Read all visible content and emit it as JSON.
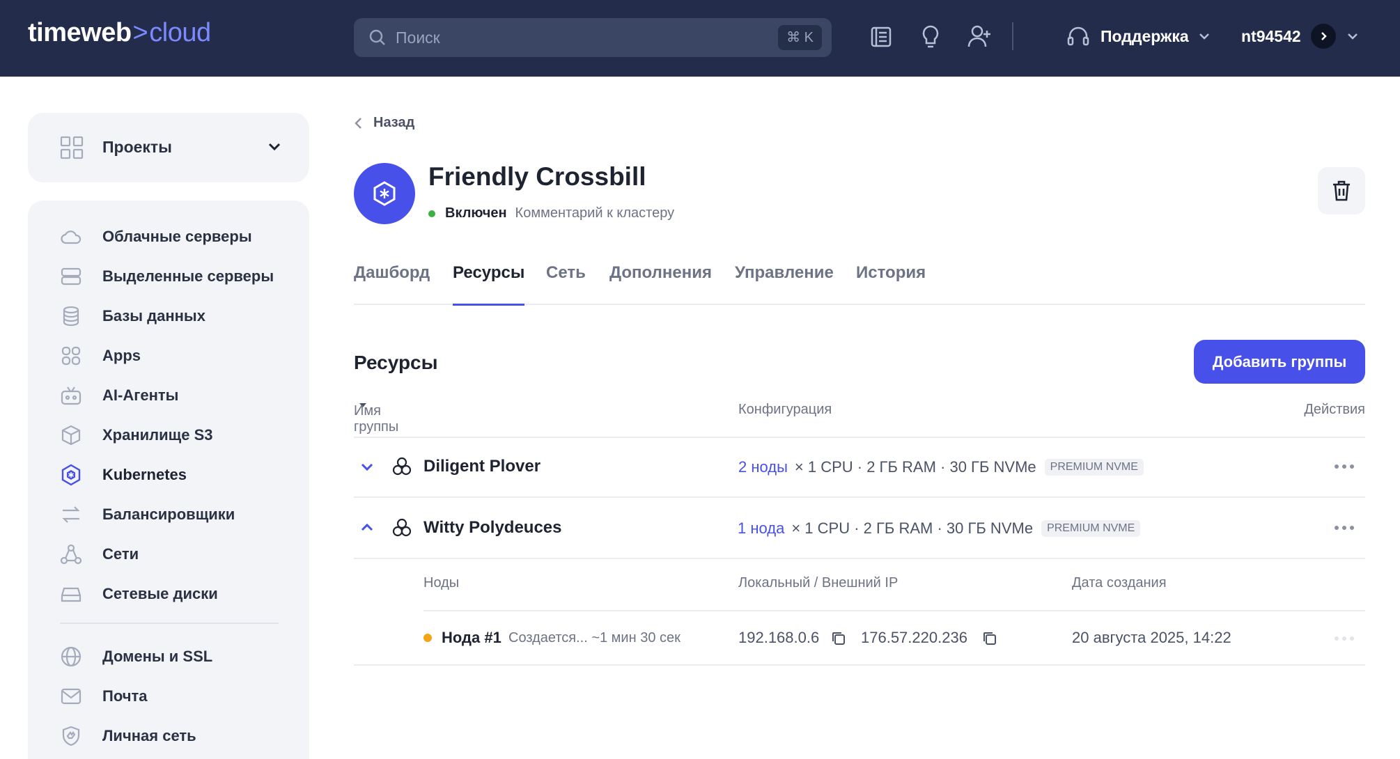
{
  "header": {
    "logo": {
      "part1": "timeweb",
      "part2": "cloud"
    },
    "search": {
      "placeholder": "Поиск",
      "shortcut": "⌘ K"
    },
    "icons": [
      "docs-icon",
      "lightbulb-icon",
      "add-user-icon"
    ],
    "support": "Поддержка",
    "user": "nt94542"
  },
  "sidebar": {
    "projects": "Проекты",
    "items": [
      {
        "label": "Облачные серверы",
        "icon": "cloud-icon"
      },
      {
        "label": "Выделенные серверы",
        "icon": "server-icon"
      },
      {
        "label": "Базы данных",
        "icon": "database-icon"
      },
      {
        "label": "Apps",
        "icon": "apps-icon"
      },
      {
        "label": "AI-Агенты",
        "icon": "robot-icon"
      },
      {
        "label": "Хранилище S3",
        "icon": "box-icon"
      },
      {
        "label": "Kubernetes",
        "icon": "kubernetes-icon",
        "active": true
      },
      {
        "label": "Балансировщики",
        "icon": "balancer-icon"
      },
      {
        "label": "Сети",
        "icon": "network-icon"
      },
      {
        "label": "Сетевые диски",
        "icon": "disk-icon"
      },
      {
        "label": "Домены и SSL",
        "icon": "globe-icon"
      },
      {
        "label": "Почта",
        "icon": "mail-icon"
      },
      {
        "label": "Личная сеть",
        "icon": "shield-icon"
      }
    ]
  },
  "main": {
    "back": "Назад",
    "cluster": {
      "name": "Friendly Crossbill",
      "status": "Включен",
      "comment": "Комментарий к кластеру"
    },
    "tabs": [
      "Дашборд",
      "Ресурсы",
      "Сеть",
      "Дополнения",
      "Управление",
      "История"
    ],
    "active_tab": "Ресурсы",
    "section_title": "Ресурсы",
    "add_button": "Добавить группы",
    "table": {
      "headers": {
        "name": "Имя группы",
        "config": "Конфигурация",
        "actions": "Действия"
      },
      "groups": [
        {
          "name": "Diligent Plover",
          "nodes": "2 ноды",
          "config": "× 1 CPU · 2 ГБ RAM · 30 ГБ NVMe",
          "badge": "PREMIUM NVME",
          "expanded": false
        },
        {
          "name": "Witty Polydeuces",
          "nodes": "1 нода",
          "config": "× 1 CPU · 2 ГБ RAM · 30 ГБ NVMe",
          "badge": "PREMIUM NVME",
          "expanded": true
        }
      ],
      "subheaders": {
        "nodes": "Ноды",
        "ip": "Локальный / Внешний IP",
        "created": "Дата создания"
      },
      "nodes": [
        {
          "name": "Нода #1",
          "status": "Создается... ~1 мин 30 сек",
          "local_ip": "192.168.0.6",
          "external_ip": "176.57.220.236",
          "created": "20 августа 2025, 14:22"
        }
      ]
    }
  },
  "colors": {
    "header_bg": "#232d4b",
    "accent": "#4750e8",
    "sidebar_bg": "#f3f4f7",
    "status_on": "#3cb043",
    "status_creating": "#f2a516"
  }
}
